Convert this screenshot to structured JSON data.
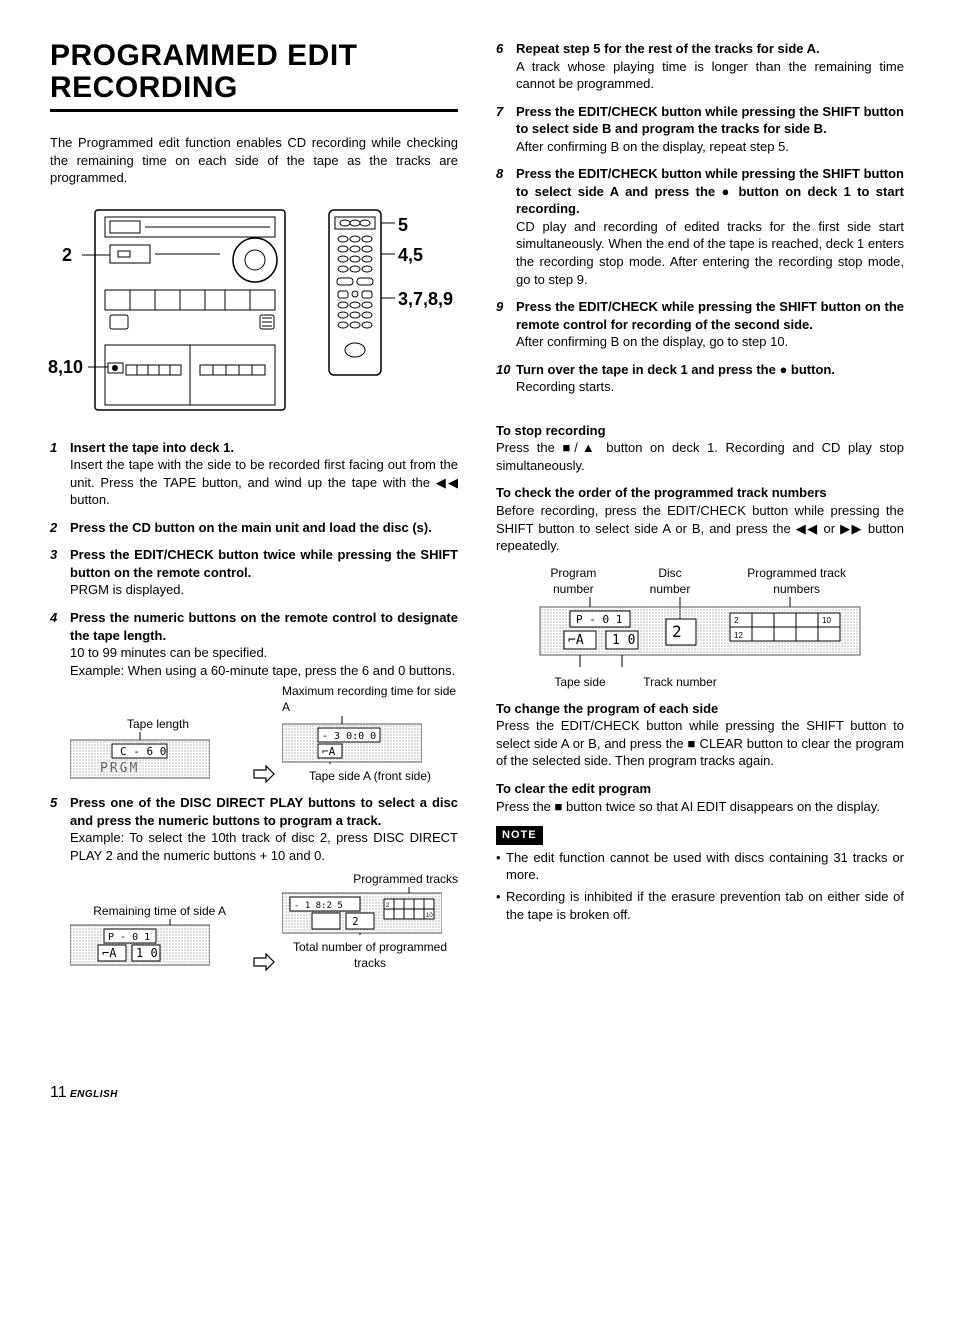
{
  "title_line1": "PROGRAMMED EDIT",
  "title_line2": "RECORDING",
  "intro": "The Programmed edit function enables CD recording while checking the remaining time on each side of the tape as the tracks are programmed.",
  "callouts": {
    "c2": "2",
    "c8_10": "8,10",
    "c5": "5",
    "c4_5": "4,5",
    "c3_7_8_9": "3,7,8,9"
  },
  "steps_left": [
    {
      "num": "1",
      "bold": "Insert the tape into deck 1.",
      "text": "Insert the tape with the side to be recorded first facing out from the unit. Press the TAPE button, and wind up the tape with the ◀◀ button."
    },
    {
      "num": "2",
      "bold": "Press the CD button on the main unit and load the disc (s).",
      "text": ""
    },
    {
      "num": "3",
      "bold": "Press the EDIT/CHECK button twice while pressing the SHIFT button on the remote control.",
      "text": "PRGM is displayed."
    },
    {
      "num": "4",
      "bold": "Press the numeric buttons on the remote control to designate the tape length.",
      "text": "10 to 99 minutes can be specified.\nExample: When using a 60-minute tape, press the 6 and 0 buttons."
    },
    {
      "num": "5",
      "bold": "Press one of the DISC DIRECT PLAY buttons to select a disc and press the numeric buttons to program a track.",
      "text": "Example: To select the 10th track of disc 2, press DISC DIRECT PLAY 2 and the numeric buttons + 10 and 0."
    }
  ],
  "steps_right": [
    {
      "num": "6",
      "bold": "Repeat step 5 for the rest of the tracks for side A.",
      "text": "A track whose playing time is longer than the remaining time cannot be programmed."
    },
    {
      "num": "7",
      "bold": "Press the EDIT/CHECK button while pressing the SHIFT button to select side B and program the tracks for side B.",
      "text": "After confirming B on the display, repeat step 5."
    },
    {
      "num": "8",
      "bold": "Press the EDIT/CHECK button while pressing the SHIFT button to select side A and press the ● button on deck 1 to start recording.",
      "text": "CD play and recording of edited tracks for the first side start simultaneously. When the end of the tape is reached, deck 1 enters the recording stop mode. After entering the recording stop mode, go to step 9."
    },
    {
      "num": "9",
      "bold": "Press the EDIT/CHECK while pressing the SHIFT button on the remote control for recording of the second side.",
      "text": "After confirming B on the display, go to step 10."
    },
    {
      "num": "10",
      "bold": "Turn over the tape in deck 1 and press the ● button.",
      "text": "Recording starts."
    }
  ],
  "stop_head": "To stop recording",
  "stop_text": "Press the ■/▲ button on deck 1. Recording and CD play stop simultaneously.",
  "check_head": "To check the order of the programmed track numbers",
  "check_text": "Before recording, press the EDIT/CHECK button while pressing the SHIFT button to select side A or B, and press the ◀◀ or ▶▶ button repeatedly.",
  "check_labels": {
    "program_number": "Program number",
    "disc_number": "Disc number",
    "programmed_track_numbers": "Programmed track numbers",
    "tape_side": "Tape side",
    "track_number": "Track number"
  },
  "change_head": "To change the program of each side",
  "change_text": "Press the EDIT/CHECK button while pressing the SHIFT button to select side A or B, and press the ■ CLEAR button to clear the program of the selected side. Then program tracks again.",
  "clear_head": "To clear the edit program",
  "clear_text": "Press the ■ button twice so that AI EDIT disappears on the display.",
  "note_label": "NOTE",
  "notes": [
    "The edit function cannot be used with discs containing 31 tracks or more.",
    "Recording is inhibited if the erasure prevention tab on either side of the tape is broken off."
  ],
  "step4_labels": {
    "tape_length": "Tape length",
    "max_rec": "Maximum recording time for side A",
    "tape_side_a": "Tape side A (front side)"
  },
  "step5_labels": {
    "remaining": "Remaining time of side A",
    "prog_tracks": "Programmed tracks",
    "total_prog": "Total number of programmed tracks"
  },
  "footer_page": "11",
  "footer_lang": "ENGLISH"
}
